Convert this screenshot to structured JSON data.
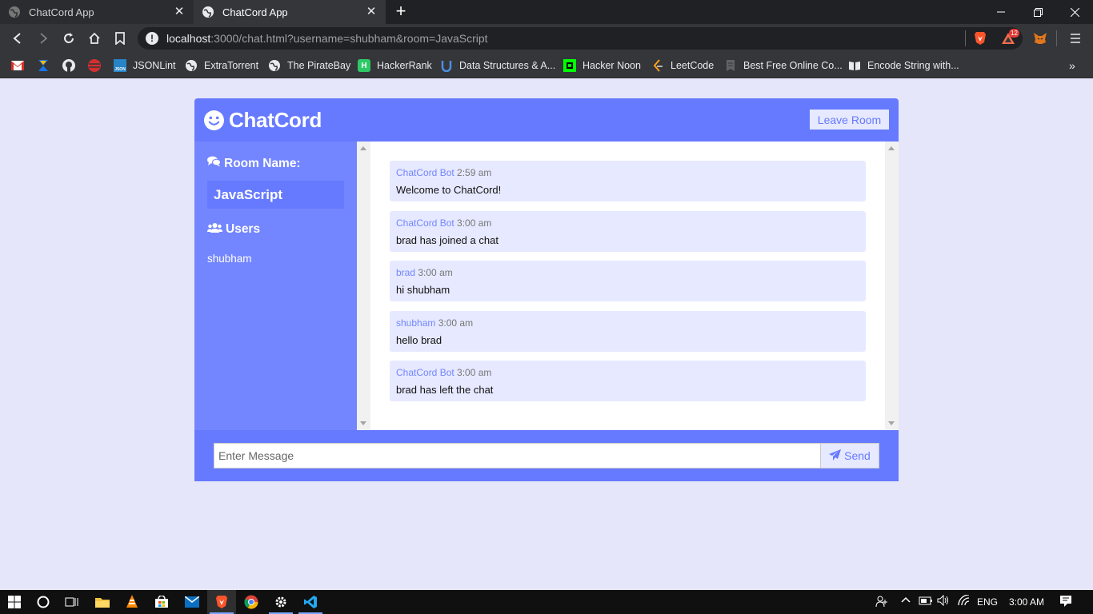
{
  "browser": {
    "tabs": [
      {
        "title": "ChatCord App",
        "active": false
      },
      {
        "title": "ChatCord App",
        "active": true
      }
    ],
    "url_host": "localhost",
    "url_rest": ":3000/chat.html?username=shubham&room=JavaScript",
    "extension_badge": "12",
    "bookmarks": [
      {
        "label": "",
        "icon": "gmail-icon"
      },
      {
        "label": "",
        "icon": "hourglass-icon"
      },
      {
        "label": "",
        "icon": "github-icon"
      },
      {
        "label": "",
        "icon": "red-globe-icon"
      },
      {
        "label": "JSONLint",
        "icon": "json-icon"
      },
      {
        "label": "ExtraTorrent",
        "icon": "globe-icon"
      },
      {
        "label": "The PirateBay",
        "icon": "globe-icon"
      },
      {
        "label": "HackerRank",
        "icon": "hackerrank-icon"
      },
      {
        "label": "Data Structures & A...",
        "icon": "udemy-icon"
      },
      {
        "label": "Hacker Noon",
        "icon": "hackernoon-icon"
      },
      {
        "label": "LeetCode",
        "icon": "leetcode-icon"
      },
      {
        "label": "Best Free Online Co...",
        "icon": "doc-icon"
      },
      {
        "label": "Encode String with...",
        "icon": "book-icon"
      }
    ]
  },
  "app": {
    "title": "ChatCord",
    "leave_button": "Leave Room",
    "room_heading": "Room Name:",
    "room_name": "JavaScript",
    "users_heading": "Users",
    "users": [
      "shubham"
    ],
    "messages": [
      {
        "user": "ChatCord Bot",
        "time": "2:59 am",
        "text": "Welcome to ChatCord!"
      },
      {
        "user": "ChatCord Bot",
        "time": "3:00 am",
        "text": "brad has joined a chat"
      },
      {
        "user": "brad",
        "time": "3:00 am",
        "text": "hi shubham"
      },
      {
        "user": "shubham",
        "time": "3:00 am",
        "text": "hello brad"
      },
      {
        "user": "ChatCord Bot",
        "time": "3:00 am",
        "text": "brad has left the chat"
      }
    ],
    "input_placeholder": "Enter Message",
    "send_button": "Send",
    "colors": {
      "primary": "#667aff",
      "secondary": "#7386ff",
      "light": "#e6e9ff",
      "page": "#e6e6fa"
    }
  },
  "taskbar": {
    "language": "ENG",
    "time": "3:00 AM"
  }
}
